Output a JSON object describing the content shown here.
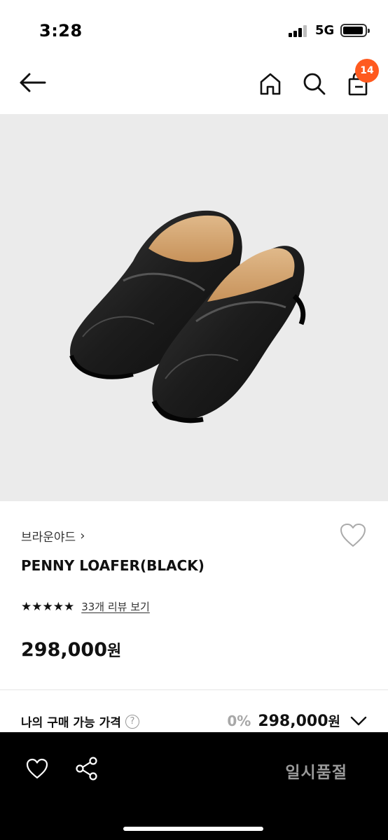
{
  "status_bar": {
    "time": "3:28",
    "network": "5G"
  },
  "nav": {
    "cart_count": "14",
    "icons": [
      "back-arrow-icon",
      "home-icon",
      "search-icon",
      "shopping-bag-icon"
    ]
  },
  "product": {
    "brand": "브라운야드",
    "brand_chevron": "›",
    "name": "PENNY LOAFER(BLACK)",
    "rating_stars": "★★★★★",
    "rating_value": 5,
    "review_link": "33개 리뷰 보기",
    "price": "298,000",
    "price_unit": "원",
    "image_bg": "#ebebeb"
  },
  "my_purchase": {
    "label": "나의 구매 가능 가격",
    "help": "?",
    "discount": "0%",
    "price": "298,000",
    "price_unit": "원"
  },
  "bottom_bar": {
    "status_label": "일시품절",
    "background": "#000000"
  },
  "colors": {
    "badge": "#ff5a1f",
    "text": "#111111",
    "muted": "#a8a8a8"
  }
}
